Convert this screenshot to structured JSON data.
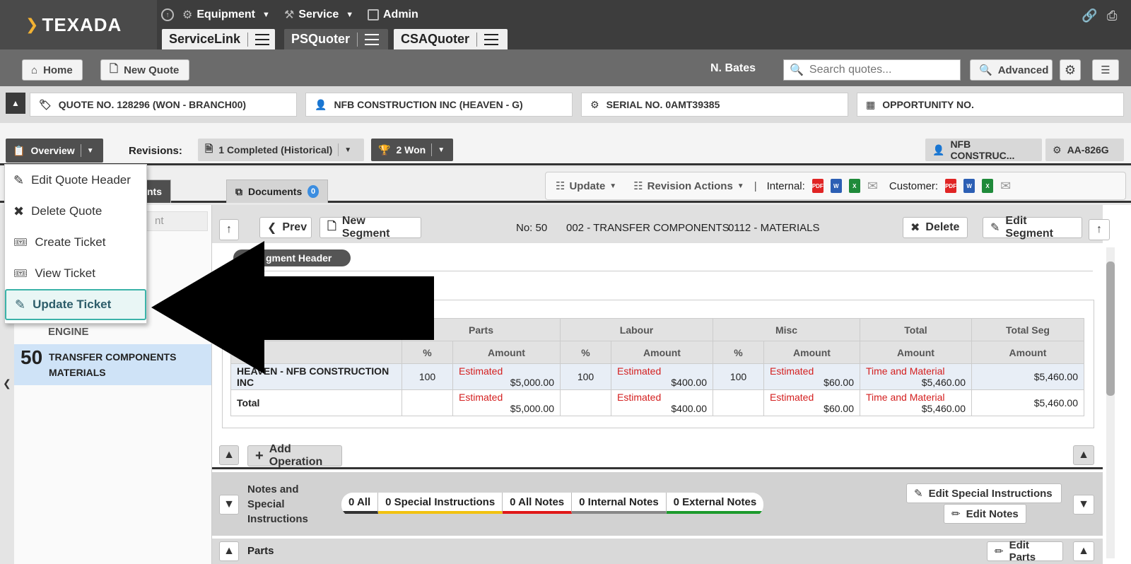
{
  "brand": {
    "logo": "TEXADA"
  },
  "topnav": {
    "equipment": "Equipment",
    "service": "Service",
    "admin": "Admin"
  },
  "apptabs": [
    {
      "label": "ServiceLink"
    },
    {
      "label": "PSQuoter"
    },
    {
      "label": "CSAQuoter"
    }
  ],
  "toolbar": {
    "home": "Home",
    "new_quote": "New Quote",
    "user": "N. Bates",
    "search_placeholder": "Search quotes...",
    "advanced": "Advanced"
  },
  "info": {
    "quote": "QUOTE NO. 128296 (WON - BRANCH00)",
    "customer": "NFB CONSTRUCTION INC (HEAVEN - G)",
    "serial": "SERIAL NO. 0AMT39385",
    "opportunity": "OPPORTUNITY NO."
  },
  "overview": {
    "label": "Overview",
    "revisions_label": "Revisions:",
    "completed": "1 Completed (Historical)",
    "won": "2 Won",
    "cust_short": "NFB CONSTRUC...",
    "unit": "AA-826G"
  },
  "tabs": {
    "first_tail": "ents",
    "documents": "Documents",
    "documents_count": "0"
  },
  "actions": {
    "update": "Update",
    "revision_actions": "Revision Actions",
    "internal": "Internal:",
    "customer": "Customer:"
  },
  "menu": {
    "items": [
      {
        "label": "Edit Quote Header"
      },
      {
        "label": "Delete Quote"
      },
      {
        "label": "Create Ticket"
      },
      {
        "label": "View Ticket"
      },
      {
        "label": "Update Ticket"
      }
    ]
  },
  "sidebar": {
    "search_tail": "nt",
    "engine": "ENGINE",
    "seg_no": "50",
    "seg_line1": "TRANSFER COMPONENTS",
    "seg_line2": "MATERIALS"
  },
  "segment": {
    "prev": "Prev",
    "new_segment": "New Segment",
    "no": "No: 50",
    "code1": "002 - TRANSFER COMPONENTS",
    "code2": "0112 - MATERIALS",
    "delete": "Delete",
    "edit_segment": "Edit Segment",
    "header_title": "gment Header"
  },
  "totals": {
    "groups": [
      "Parts",
      "Labour",
      "Misc",
      "Total",
      "Total Seg"
    ],
    "pct": "%",
    "amount": "Amount",
    "rows": [
      {
        "label": "HEAVEN - NFB CONSTRUCTION INC",
        "parts_pct": "100",
        "parts_status": "Estimated",
        "parts_amt": "$5,000.00",
        "labour_pct": "100",
        "labour_status": "Estimated",
        "labour_amt": "$400.00",
        "misc_pct": "100",
        "misc_status": "Estimated",
        "misc_amt": "$60.00",
        "total_status": "Time and Material",
        "total_amt": "$5,460.00",
        "seg_amt": "$5,460.00"
      },
      {
        "label": "Total",
        "parts_status": "Estimated",
        "parts_amt": "$5,000.00",
        "labour_status": "Estimated",
        "labour_amt": "$400.00",
        "misc_status": "Estimated",
        "misc_amt": "$60.00",
        "total_status": "Time and Material",
        "total_amt": "$5,460.00",
        "seg_amt": "$5,460.00"
      }
    ]
  },
  "operation": {
    "add": "Add Operation"
  },
  "notes": {
    "title_line1": "Notes and",
    "title_line2": "Special",
    "title_line3": "Instructions",
    "all": "0 All",
    "special": "0 Special Instructions",
    "all_notes": "0 All Notes",
    "internal": "0 Internal Notes",
    "external": "0 External Notes",
    "edit_special": "Edit Special Instructions",
    "edit_notes": "Edit Notes"
  },
  "parts": {
    "title": "Parts",
    "edit": "Edit Parts"
  },
  "colors": {
    "special_bar": "#f2c20f",
    "all_notes_bar": "#e01818",
    "internal_bar": "#888888",
    "external_bar": "#1c9a2c",
    "estimated": "#d42020",
    "highlight": "#3bb3a9"
  }
}
